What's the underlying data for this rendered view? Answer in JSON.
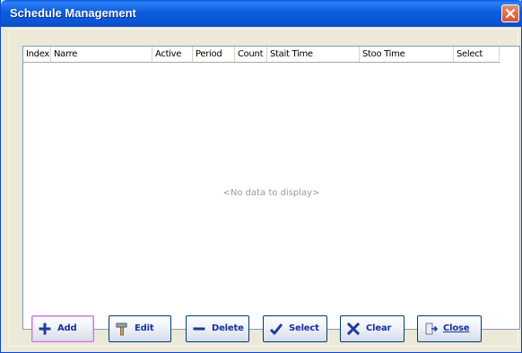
{
  "window": {
    "title": "Schedule Management",
    "close_icon": "close-icon"
  },
  "grid": {
    "columns": [
      "Index",
      "Narre",
      "Active",
      "Period",
      "Count",
      "Stait Time",
      "Stoo Time",
      "Select"
    ],
    "rows": [],
    "empty_text": "<No data to display>"
  },
  "buttons": {
    "add": {
      "label": "Add",
      "icon": "plus-icon"
    },
    "edit": {
      "label": "Edit",
      "icon": "hammer-icon"
    },
    "delete": {
      "label": "Delete",
      "icon": "minus-icon"
    },
    "select": {
      "label": "Select",
      "icon": "checkmark-icon"
    },
    "clear": {
      "label": "Clear",
      "icon": "x-icon"
    },
    "close": {
      "label": "Close",
      "icon": "exit-door-icon"
    }
  },
  "colors": {
    "titlebar": "#0a56d4",
    "button_text": "#1a2fa0",
    "grid_border": "#7f9db9"
  }
}
